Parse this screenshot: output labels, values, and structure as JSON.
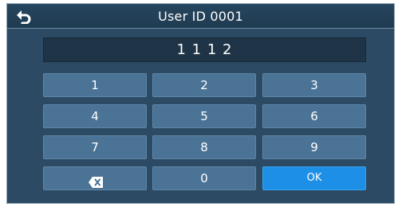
{
  "header": {
    "title": "User ID 0001",
    "back_icon": "undo-arrow-icon"
  },
  "entry": {
    "value": "1 1 1 2"
  },
  "keypad": {
    "keys": [
      "1",
      "2",
      "3",
      "4",
      "5",
      "6",
      "7",
      "8",
      "9"
    ],
    "backspace_icon": "backspace-icon",
    "zero": "0",
    "ok": "OK"
  },
  "colors": {
    "background": "#2c4a63",
    "key": "#4a7396",
    "ok_accent": "#1e8fe6"
  }
}
